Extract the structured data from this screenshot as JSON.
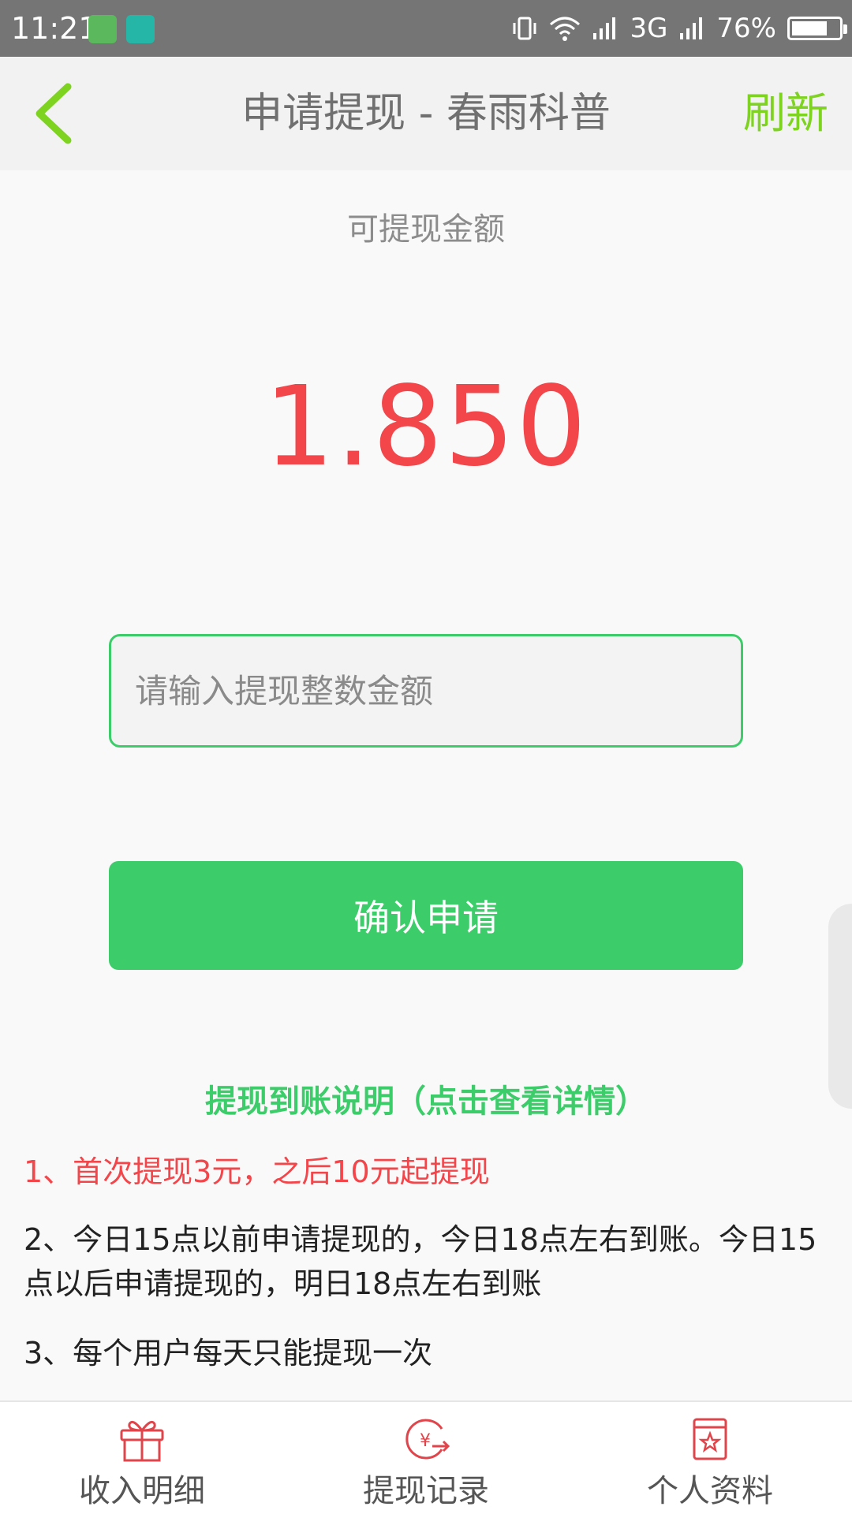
{
  "status_bar": {
    "time": "11:21",
    "network": "3G",
    "battery": "76%",
    "battery_level": 0.76
  },
  "header": {
    "title": "申请提现 - 春雨科普",
    "refresh_label": "刷新"
  },
  "balance": {
    "label": "可提现金额",
    "amount": "1.850"
  },
  "withdraw_form": {
    "placeholder": "请输入提现整数金额",
    "value": "",
    "confirm_label": "确认申请"
  },
  "notes": {
    "link": "提现到账说明（点击查看详情）",
    "items": [
      "1、首次提现3元，之后10元起提现",
      "2、今日15点以前申请提现的，今日18点左右到账。今日15点以后申请提现的，明日18点左右到账",
      "3、每个用户每天只能提现一次"
    ]
  },
  "bottom_nav": {
    "items": [
      {
        "label": "收入明细",
        "icon": "gift-icon"
      },
      {
        "label": "提现记录",
        "icon": "yuan-transfer-icon"
      },
      {
        "label": "个人资料",
        "icon": "profile-card-icon"
      }
    ]
  },
  "colors": {
    "accent_green": "#3ccd6a",
    "refresh_green": "#7ed321",
    "amount_red": "#f2464b",
    "nav_icon_red": "#e0454b"
  }
}
